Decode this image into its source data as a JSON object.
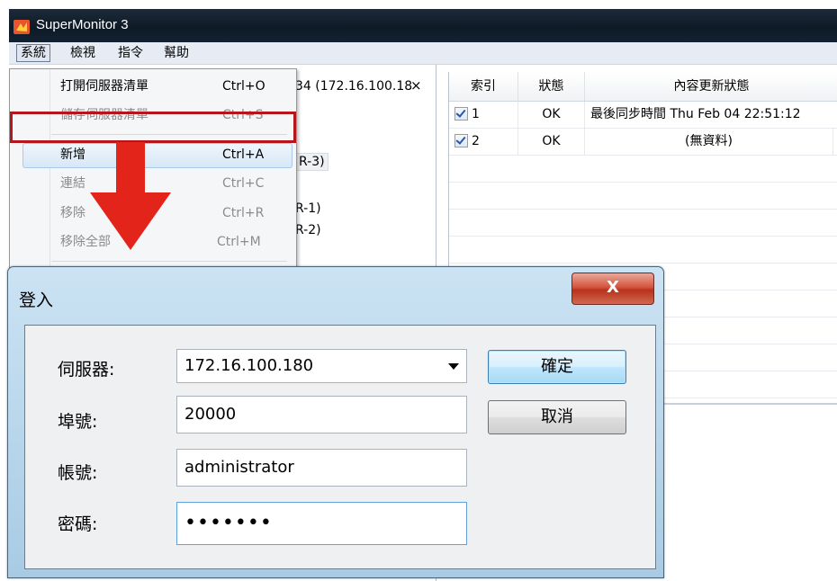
{
  "window": {
    "title": "SuperMonitor 3"
  },
  "menubar": [
    {
      "label": "系統",
      "active": true
    },
    {
      "label": "檢視"
    },
    {
      "label": "指令"
    },
    {
      "label": "幫助"
    }
  ],
  "left_panel": {
    "close_glyph": "×",
    "lines": [
      "34  (172.16.100.18",
      "R-3)",
      "R-1)",
      "R-2)"
    ]
  },
  "grid": {
    "headers": [
      "索引",
      "狀態",
      "內容更新狀態"
    ],
    "rows": [
      {
        "index": "1",
        "status": "OK",
        "content": "最後同步時間 Thu Feb 04 22:51:12"
      },
      {
        "index": "2",
        "status": "OK",
        "content": "(無資料)"
      }
    ]
  },
  "context_menu": {
    "items": [
      {
        "label": "打開伺服器清單",
        "shortcut": "Ctrl+O",
        "disabled": false
      },
      {
        "label": "儲存伺服器清單",
        "shortcut": "Ctrl+S",
        "disabled": true
      },
      {
        "label": "新增",
        "shortcut": "Ctrl+A",
        "disabled": false,
        "highlighted": true
      },
      {
        "label": "連結",
        "shortcut": "Ctrl+C",
        "disabled": true
      },
      {
        "label": "移除",
        "shortcut": "Ctrl+R",
        "disabled": true
      },
      {
        "label": "移除全部",
        "shortcut": "Ctrl+M",
        "disabled": true
      }
    ]
  },
  "annotation": {
    "box_color": "#b5161c",
    "arrow_color": "#e3241b"
  },
  "dialog": {
    "title": "登入",
    "close_glyph": "X",
    "fields": {
      "server_label": "伺服器:",
      "server_value": "172.16.100.180",
      "port_label": "埠號:",
      "port_value": "20000",
      "account_label": "帳號:",
      "account_value": "administrator",
      "password_label": "密碼:",
      "password_value": "•••••••"
    },
    "ok_label": "確定",
    "cancel_label": "取消"
  }
}
